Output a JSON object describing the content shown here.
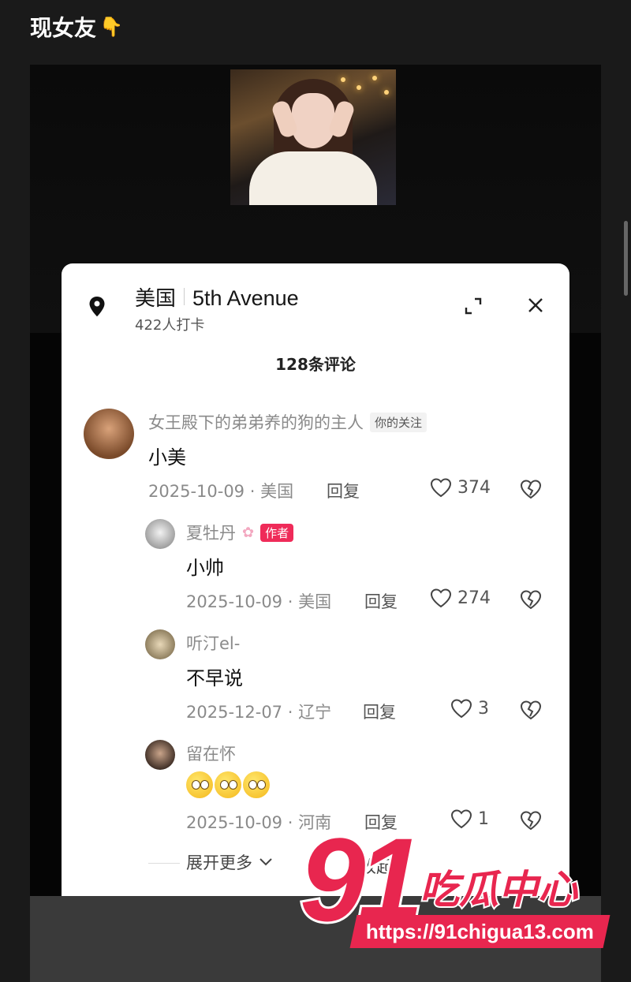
{
  "post": {
    "title": "现女友",
    "title_emoji": "👇"
  },
  "location": {
    "country": "美国",
    "place": "5th Avenue",
    "checkins": "422人打卡"
  },
  "comments_count": "128条评论",
  "comments": [
    {
      "user": "女王殿下的弟弟养的狗的主人",
      "tag": "你的关注",
      "text": "小美",
      "date": "2025-10-09 · 美国",
      "reply": "回复",
      "likes": "374"
    },
    {
      "user": "夏牡丹",
      "tag": "作者",
      "text": "小帅",
      "date": "2025-10-09 · 美国",
      "reply": "回复",
      "likes": "274"
    },
    {
      "user": "听汀el-",
      "text": "不早说",
      "date": "2025-12-07 · 辽宁",
      "reply": "回复",
      "likes": "3"
    },
    {
      "user": "留在怀",
      "text": "",
      "date": "2025-10-09 · 河南",
      "reply": "回复",
      "likes": "1"
    }
  ],
  "expand_more": "展开更多",
  "partial_text": "收起",
  "watermark": {
    "big": "91",
    "cn": "吃瓜中心",
    "url": "https://91chigua13.com"
  },
  "colors": {
    "accent": "#e8264f",
    "author_tag": "#ef2b59"
  }
}
